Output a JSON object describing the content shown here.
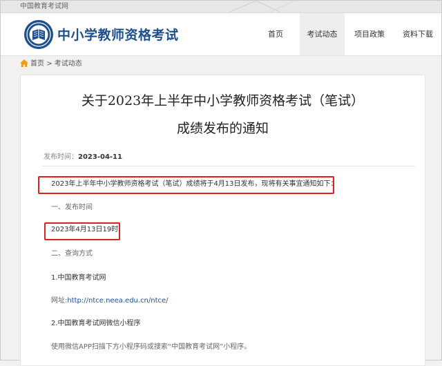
{
  "topbar": {
    "site_name": "中国教育考试网"
  },
  "header": {
    "logo_text": "中小学教师资格考试",
    "nav": [
      {
        "label": "首页",
        "active": false
      },
      {
        "label": "考试动态",
        "active": true
      },
      {
        "label": "项目政策",
        "active": false
      },
      {
        "label": "资料下载",
        "active": false
      }
    ]
  },
  "breadcrumb": {
    "home": "首页",
    "separator": ">",
    "current": "考试动态"
  },
  "article": {
    "title_line1": "关于2023年上半年中小学教师资格考试（笔试）",
    "title_line2": "成绩发布的通知",
    "date_label": "发布时间：",
    "date_value": "2023-04-11",
    "intro": "2023年上半年中小学教师资格考试（笔试）成绩将于4月13日发布，现将有关事宜通知如下：",
    "section1_heading": "一、发布时间",
    "release_time": "2023年4月13日19时",
    "section2_heading": "二、查询方式",
    "method1": "1.中国教育考试网",
    "url_label": "网址:",
    "url": "http://ntce.neea.edu.cn/ntce/",
    "method2": "2.中国教育考试网微信小程序",
    "wechat_note": "使用微信APP扫描下方小程序码或搜索“中国教育考试网”小程序。"
  },
  "colors": {
    "brand": "#1d4f8c",
    "highlight": "#e02020",
    "link": "#1a4fa0",
    "home_icon": "#f39c12"
  }
}
